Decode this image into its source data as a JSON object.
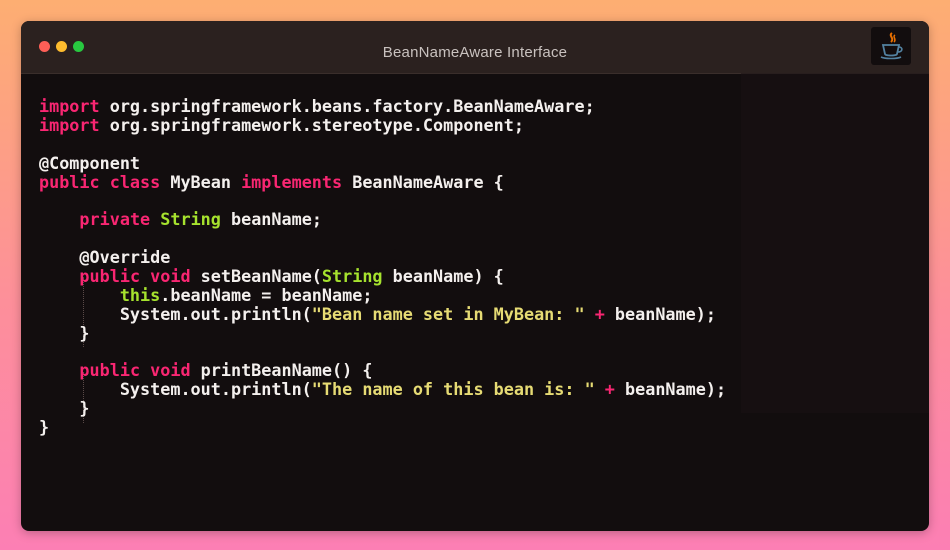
{
  "window": {
    "title": "BeanNameAware Interface",
    "logo_icon": "java-cup-icon"
  },
  "colors": {
    "keyword": "#f92672",
    "type": "#a6e22e",
    "string": "#e6db74",
    "plain": "#f4f0ee",
    "background": "#120d0e",
    "titlebar": "#2b211f"
  },
  "code": {
    "language": "java",
    "lines": [
      [
        {
          "t": "import",
          "c": "kw"
        },
        {
          "t": " org.springframework.beans.factory.BeanNameAware;",
          "c": "pl"
        }
      ],
      [
        {
          "t": "import",
          "c": "kw"
        },
        {
          "t": " org.springframework.stereotype.Component;",
          "c": "pl"
        }
      ],
      [],
      [
        {
          "t": "@Component",
          "c": "pl"
        }
      ],
      [
        {
          "t": "public class",
          "c": "kw"
        },
        {
          "t": " MyBean ",
          "c": "pl"
        },
        {
          "t": "implements",
          "c": "kw"
        },
        {
          "t": " BeanNameAware {",
          "c": "pl"
        }
      ],
      [],
      [
        {
          "t": "    ",
          "c": "pl"
        },
        {
          "t": "private",
          "c": "kw"
        },
        {
          "t": " ",
          "c": "pl"
        },
        {
          "t": "String",
          "c": "ty"
        },
        {
          "t": " beanName;",
          "c": "pl"
        }
      ],
      [],
      [
        {
          "t": "    @Override",
          "c": "pl"
        }
      ],
      [
        {
          "t": "    ",
          "c": "pl"
        },
        {
          "t": "public void",
          "c": "kw"
        },
        {
          "t": " setBeanName(",
          "c": "pl"
        },
        {
          "t": "String",
          "c": "ty"
        },
        {
          "t": " beanName) {",
          "c": "pl"
        }
      ],
      [
        {
          "t": "        ",
          "c": "pl"
        },
        {
          "t": "this",
          "c": "ty"
        },
        {
          "t": ".beanName = beanName;",
          "c": "pl"
        }
      ],
      [
        {
          "t": "        System.out.println(",
          "c": "pl"
        },
        {
          "t": "\"Bean name set in MyBean: \"",
          "c": "st"
        },
        {
          "t": " ",
          "c": "pl"
        },
        {
          "t": "+",
          "c": "kw"
        },
        {
          "t": " beanName);",
          "c": "pl"
        }
      ],
      [
        {
          "t": "    }",
          "c": "pl"
        }
      ],
      [],
      [
        {
          "t": "    ",
          "c": "pl"
        },
        {
          "t": "public void",
          "c": "kw"
        },
        {
          "t": " printBeanName() {",
          "c": "pl"
        }
      ],
      [
        {
          "t": "        System.out.println(",
          "c": "pl"
        },
        {
          "t": "\"The name of this bean is: \"",
          "c": "st"
        },
        {
          "t": " ",
          "c": "pl"
        },
        {
          "t": "+",
          "c": "kw"
        },
        {
          "t": " beanName);",
          "c": "pl"
        }
      ],
      [
        {
          "t": "    }",
          "c": "pl"
        }
      ],
      [
        {
          "t": "}",
          "c": "pl"
        }
      ]
    ]
  }
}
